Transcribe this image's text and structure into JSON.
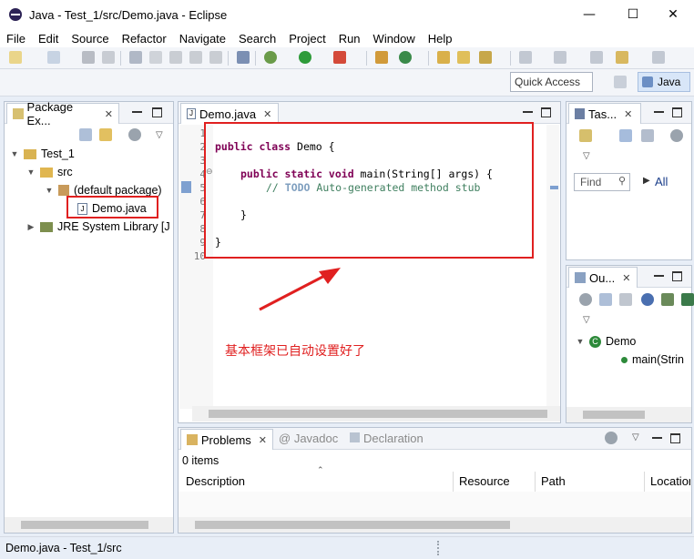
{
  "window": {
    "title": "Java - Test_1/src/Demo.java - Eclipse",
    "minimize": "—",
    "maximize": "☐",
    "close": "✕"
  },
  "menu": [
    "File",
    "Edit",
    "Source",
    "Refactor",
    "Navigate",
    "Search",
    "Project",
    "Run",
    "Window",
    "Help"
  ],
  "quick_access": {
    "placeholder": "Quick Access"
  },
  "perspective": {
    "label": "Java"
  },
  "package_explorer": {
    "tab_label": "Package Ex...",
    "tree": [
      {
        "label": "Test_1",
        "icon": "project-folder-icon",
        "expanded": true
      },
      {
        "label": "src",
        "icon": "source-folder-icon",
        "expanded": true
      },
      {
        "label": "(default package)",
        "icon": "package-icon",
        "expanded": true
      },
      {
        "label": "Demo.java",
        "icon": "java-file-icon"
      },
      {
        "label": "JRE System Library [J",
        "icon": "library-icon",
        "expanded": false
      }
    ]
  },
  "editor": {
    "tab_label": "Demo.java",
    "line_numbers": [
      "1",
      "2",
      "3",
      "4",
      "5",
      "6",
      "7",
      "8",
      "9",
      "10"
    ],
    "code": {
      "l2_kw": "public class",
      "l2_rest": " Demo {",
      "l4_kw": "public static void",
      "l4_rest": " main(String[] args) {",
      "l5_comment_prefix": "// ",
      "l5_todo": "TODO",
      "l5_comment": " Auto-generated method stub",
      "l7": "}",
      "l9": "}"
    },
    "annotation": "基本框架已自动设置好了",
    "accent_color": "#e02020"
  },
  "task_list": {
    "tab_label": "Tas...",
    "find_placeholder": "Find",
    "all_label": "All"
  },
  "outline": {
    "tab_label": "Ou...",
    "class_label": "Demo",
    "method_label": "main(Strin"
  },
  "bottom": {
    "tabs": {
      "problems": "Problems",
      "javadoc": "Javadoc",
      "declaration": "Declaration"
    },
    "items_count": "0 items",
    "columns": [
      "Description",
      "Resource",
      "Path",
      "Location"
    ]
  },
  "status_bar": {
    "text": "Demo.java - Test_1/src"
  }
}
